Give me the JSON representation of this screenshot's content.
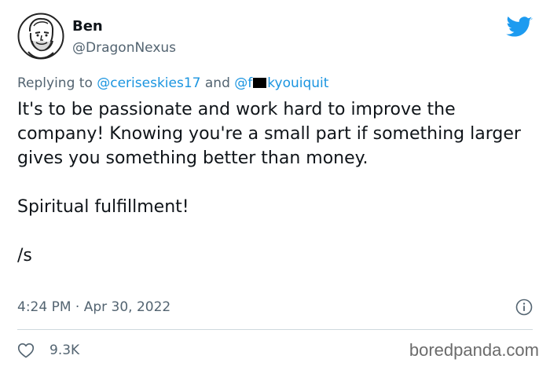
{
  "tweet": {
    "author": {
      "display_name": "Ben",
      "handle": "@DragonNexus",
      "avatar_icon": "cartoon-man-avatar-icon"
    },
    "brand_icon": "twitter-bird-icon",
    "brand_color": "#1d9bf0",
    "reply": {
      "prefix": "Replying to ",
      "mention_1": "@ceriseskies17",
      "connector": " and ",
      "mention_2_start": "@f",
      "mention_2_end": "kyouiquit"
    },
    "body": {
      "paragraph_1": "It's to be passionate and work hard to improve the company! Knowing you're a small part if something larger gives you something better than money.",
      "paragraph_2": "Spiritual fulfillment!",
      "paragraph_3": "/s"
    },
    "timestamp": "4:24 PM · Apr 30, 2022",
    "info_icon": "info-icon",
    "likes": {
      "icon": "heart-outline-icon",
      "count": "9.3K"
    }
  },
  "watermark": "boredpanda.com",
  "colors": {
    "text_primary": "#0f1419",
    "text_secondary": "#536471",
    "link": "#1b95e0",
    "divider": "#cfd9de"
  }
}
